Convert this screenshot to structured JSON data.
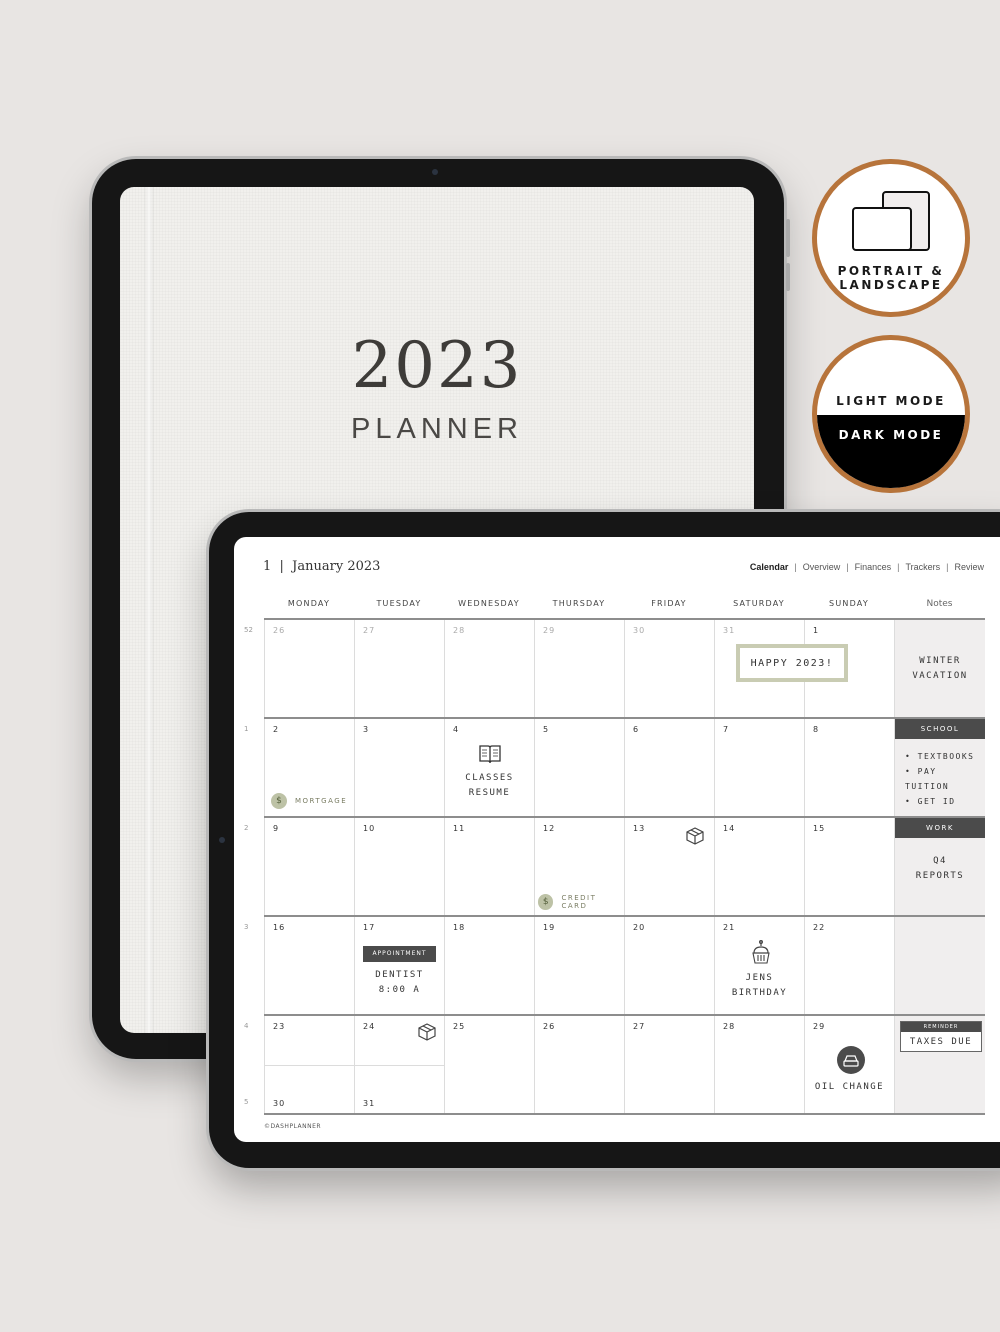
{
  "cover": {
    "year": "2023",
    "title": "PLANNER"
  },
  "badges": {
    "orientation": {
      "line1": "PORTRAIT &",
      "line2": "LANDSCAPE",
      "icon": "tablet-devices-icon"
    },
    "mode": {
      "light": "LIGHT MODE",
      "dark": "DARK MODE"
    },
    "ring_color": "#b7743b"
  },
  "planner": {
    "header": {
      "title": "1  |  January 2023"
    },
    "nav": [
      {
        "label": "Calendar",
        "active": true
      },
      {
        "label": "Overview",
        "active": false
      },
      {
        "label": "Finances",
        "active": false
      },
      {
        "label": "Trackers",
        "active": false
      },
      {
        "label": "Review",
        "active": false
      }
    ],
    "weekdays": [
      "MONDAY",
      "TUESDAY",
      "WEDNESDAY",
      "THURSDAY",
      "FRIDAY",
      "SATURDAY",
      "SUNDAY"
    ],
    "notes_header": "Notes",
    "weeks": [
      {
        "week_num": "52",
        "days": [
          "26",
          "27",
          "28",
          "29",
          "30",
          "31",
          "1"
        ]
      },
      {
        "week_num": "1",
        "days": [
          "2",
          "3",
          "4",
          "5",
          "6",
          "7",
          "8"
        ]
      },
      {
        "week_num": "2",
        "days": [
          "9",
          "10",
          "11",
          "12",
          "13",
          "14",
          "15"
        ]
      },
      {
        "week_num": "3",
        "days": [
          "16",
          "17",
          "18",
          "19",
          "20",
          "21",
          "22"
        ]
      },
      {
        "week_num": "4",
        "days": [
          "23",
          "24",
          "25",
          "26",
          "27",
          "28",
          "29"
        ]
      }
    ],
    "extra_week": {
      "week_num": "5",
      "days": [
        "30",
        "31"
      ]
    },
    "events": {
      "happy": "HAPPY 2023!",
      "mortgage": "MORTGAGE",
      "classes_line1": "CLASSES",
      "classes_line2": "RESUME",
      "credit_card": "CREDIT CARD",
      "appointment_tag": "APPOINTMENT",
      "dentist_line1": "DENTIST",
      "dentist_line2": "8:00 A",
      "birthday_line1": "JENS",
      "birthday_line2": "BIRTHDAY",
      "oil_change": "OIL CHANGE"
    },
    "notes": {
      "week52_line1": "WINTER",
      "week52_line2": "VACATION",
      "school_head": "SCHOOL",
      "school_items": [
        "• TEXTBOOKS",
        "• PAY TUITION",
        "• GET ID"
      ],
      "work_head": "WORK",
      "work_line1": "Q4",
      "work_line2": "REPORTS",
      "reminder_head": "REMINDER",
      "reminder_body": "TAXES DUE"
    },
    "footer": "©DASHPLANNER",
    "accent_sage": "#c9ccb3",
    "tag_dark": "#4b4b4b"
  }
}
